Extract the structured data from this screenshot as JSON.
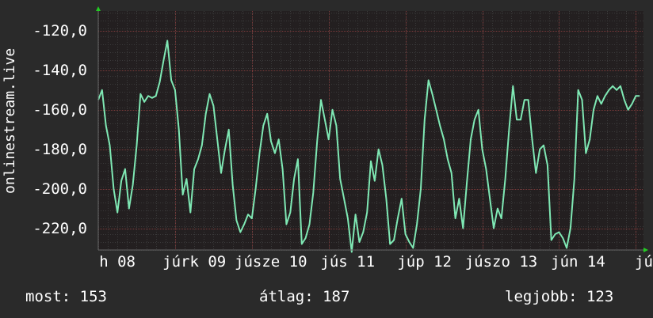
{
  "chart_data": {
    "type": "line",
    "ylabel": "onlinestream.live",
    "ylim": [
      -231,
      -110
    ],
    "y_ticks": [
      "-120,0",
      "-140,0",
      "-160,0",
      "-180,0",
      "-200,0",
      "-220,0"
    ],
    "y_tick_values": [
      -120,
      -140,
      -160,
      -180,
      -200,
      -220
    ],
    "x_ticks": [
      "h 08",
      "júrk 09",
      "júsze 10",
      "jús 11",
      "júp 12",
      "júszo 13",
      "jún 14",
      "jú"
    ],
    "x_tick_values": [
      0.25,
      1.25,
      2.25,
      3.25,
      4.25,
      5.25,
      6.25,
      7.25
    ],
    "xlim": [
      0,
      7.1
    ],
    "series": [
      {
        "color": "#7fe8b4",
        "x": [
          0.0,
          0.05,
          0.1,
          0.15,
          0.2,
          0.25,
          0.3,
          0.35,
          0.4,
          0.45,
          0.5,
          0.55,
          0.6,
          0.65,
          0.7,
          0.75,
          0.8,
          0.85,
          0.9,
          0.95,
          1.0,
          1.05,
          1.1,
          1.15,
          1.2,
          1.25,
          1.3,
          1.35,
          1.4,
          1.45,
          1.5,
          1.55,
          1.6,
          1.65,
          1.7,
          1.75,
          1.8,
          1.85,
          1.9,
          1.95,
          2.0,
          2.05,
          2.1,
          2.15,
          2.2,
          2.25,
          2.3,
          2.35,
          2.4,
          2.45,
          2.5,
          2.55,
          2.6,
          2.65,
          2.7,
          2.75,
          2.8,
          2.85,
          2.9,
          2.95,
          3.0,
          3.05,
          3.1,
          3.15,
          3.2,
          3.25,
          3.3,
          3.35,
          3.4,
          3.45,
          3.5,
          3.55,
          3.6,
          3.65,
          3.7,
          3.75,
          3.8,
          3.85,
          3.9,
          3.95,
          4.0,
          4.05,
          4.1,
          4.15,
          4.2,
          4.25,
          4.3,
          4.35,
          4.4,
          4.45,
          4.5,
          4.55,
          4.6,
          4.65,
          4.7,
          4.75,
          4.8,
          4.85,
          4.9,
          4.95,
          5.0,
          5.05,
          5.1,
          5.15,
          5.2,
          5.25,
          5.3,
          5.35,
          5.4,
          5.45,
          5.5,
          5.55,
          5.6,
          5.65,
          5.7,
          5.75,
          5.8,
          5.85,
          5.9,
          5.95,
          6.0,
          6.05,
          6.1,
          6.15,
          6.2,
          6.25,
          6.3,
          6.35,
          6.4,
          6.45,
          6.5,
          6.55,
          6.6,
          6.65,
          6.7,
          6.75,
          6.8,
          6.85,
          6.9,
          6.95,
          7.0,
          7.05
        ],
        "y": [
          -155,
          -150,
          -168,
          -178,
          -200,
          -212,
          -196,
          -190,
          -210,
          -198,
          -178,
          -152,
          -156,
          -153,
          -154,
          -153,
          -146,
          -135,
          -125,
          -145,
          -150,
          -170,
          -203,
          -195,
          -212,
          -190,
          -185,
          -178,
          -162,
          -152,
          -158,
          -175,
          -192,
          -180,
          -170,
          -198,
          -216,
          -222,
          -218,
          -213,
          -215,
          -200,
          -182,
          -168,
          -162,
          -176,
          -182,
          -175,
          -190,
          -218,
          -212,
          -195,
          -185,
          -228,
          -225,
          -218,
          -202,
          -176,
          -155,
          -165,
          -175,
          -160,
          -168,
          -195,
          -205,
          -215,
          -232,
          -213,
          -227,
          -222,
          -212,
          -186,
          -196,
          -180,
          -188,
          -205,
          -228,
          -226,
          -215,
          -205,
          -223,
          -227,
          -230,
          -218,
          -200,
          -165,
          -145,
          -152,
          -160,
          -168,
          -175,
          -185,
          -192,
          -215,
          -205,
          -220,
          -197,
          -175,
          -165,
          -160,
          -180,
          -190,
          -205,
          -220,
          -210,
          -215,
          -195,
          -170,
          -148,
          -165,
          -165,
          -155,
          -155,
          -175,
          -192,
          -180,
          -178,
          -188,
          -226,
          -223,
          -222,
          -225,
          -230,
          -220,
          -195,
          -150,
          -155,
          -182,
          -175,
          -160,
          -153,
          -157,
          -153,
          -150,
          -148,
          -150,
          -148,
          -155,
          -160,
          -157,
          -153,
          -153
        ]
      }
    ]
  },
  "stats": {
    "current": "most: 153",
    "average": "átlag: 187",
    "best": "legjobb: 123"
  }
}
